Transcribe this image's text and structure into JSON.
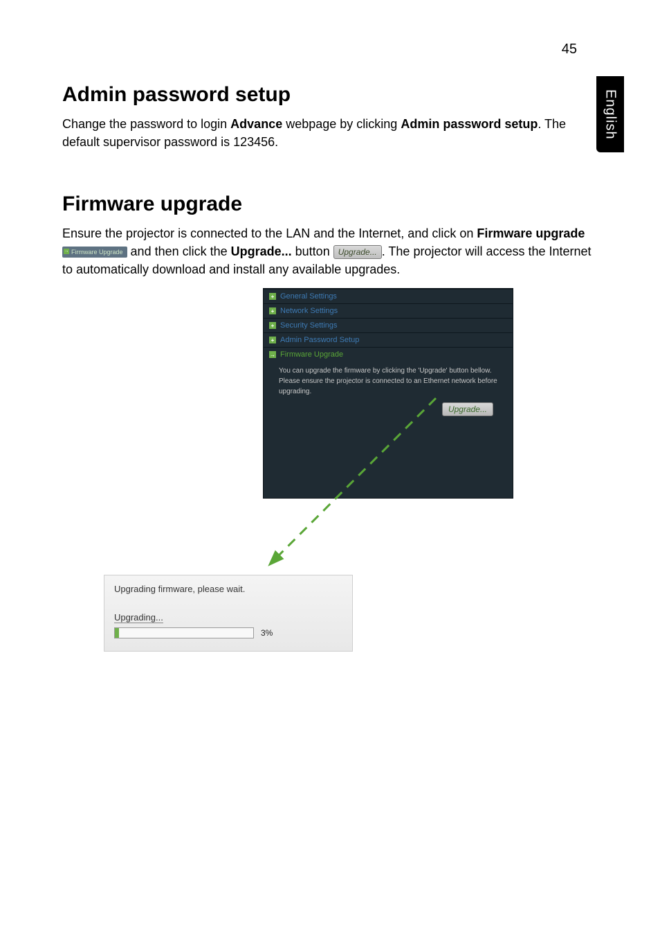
{
  "page_number": "45",
  "side_tab": "English",
  "sections": {
    "admin": {
      "heading": "Admin password setup",
      "para_parts": {
        "t1": "Change the password to login ",
        "b1": "Advance",
        "t2": " webpage by clicking ",
        "b2": "Admin password setup",
        "t3": ". The default supervisor password is 123456."
      }
    },
    "firmware": {
      "heading": "Firmware upgrade",
      "para_parts": {
        "t1": "Ensure the projector is connected to the LAN and the Internet, and click on ",
        "b1": "Firmware upgrade",
        "chip": "Firmware Upgrade",
        "t2": " and then click the ",
        "b2": "Upgrade...",
        "t3": " button ",
        "btn": "Upgrade...",
        "t4": ". The projector will access the Internet to automatically download and install any available upgrades."
      }
    }
  },
  "panel": {
    "items": [
      {
        "label": "General Settings"
      },
      {
        "label": "Network Settings"
      },
      {
        "label": "Security Settings"
      },
      {
        "label": "Admin Password Setup"
      },
      {
        "label": "Firmware Upgrade"
      }
    ],
    "body_line1": "You can upgrade the firmware by clicking the 'Upgrade' button bellow.",
    "body_line2": "Please ensure the projector is connected to an Ethernet network before upgrading.",
    "upgrade_btn": "Upgrade..."
  },
  "progress": {
    "line1": "Upgrading firmware, please wait.",
    "line2": "Upgrading...",
    "percent_text": "3%",
    "percent_value": 3
  }
}
